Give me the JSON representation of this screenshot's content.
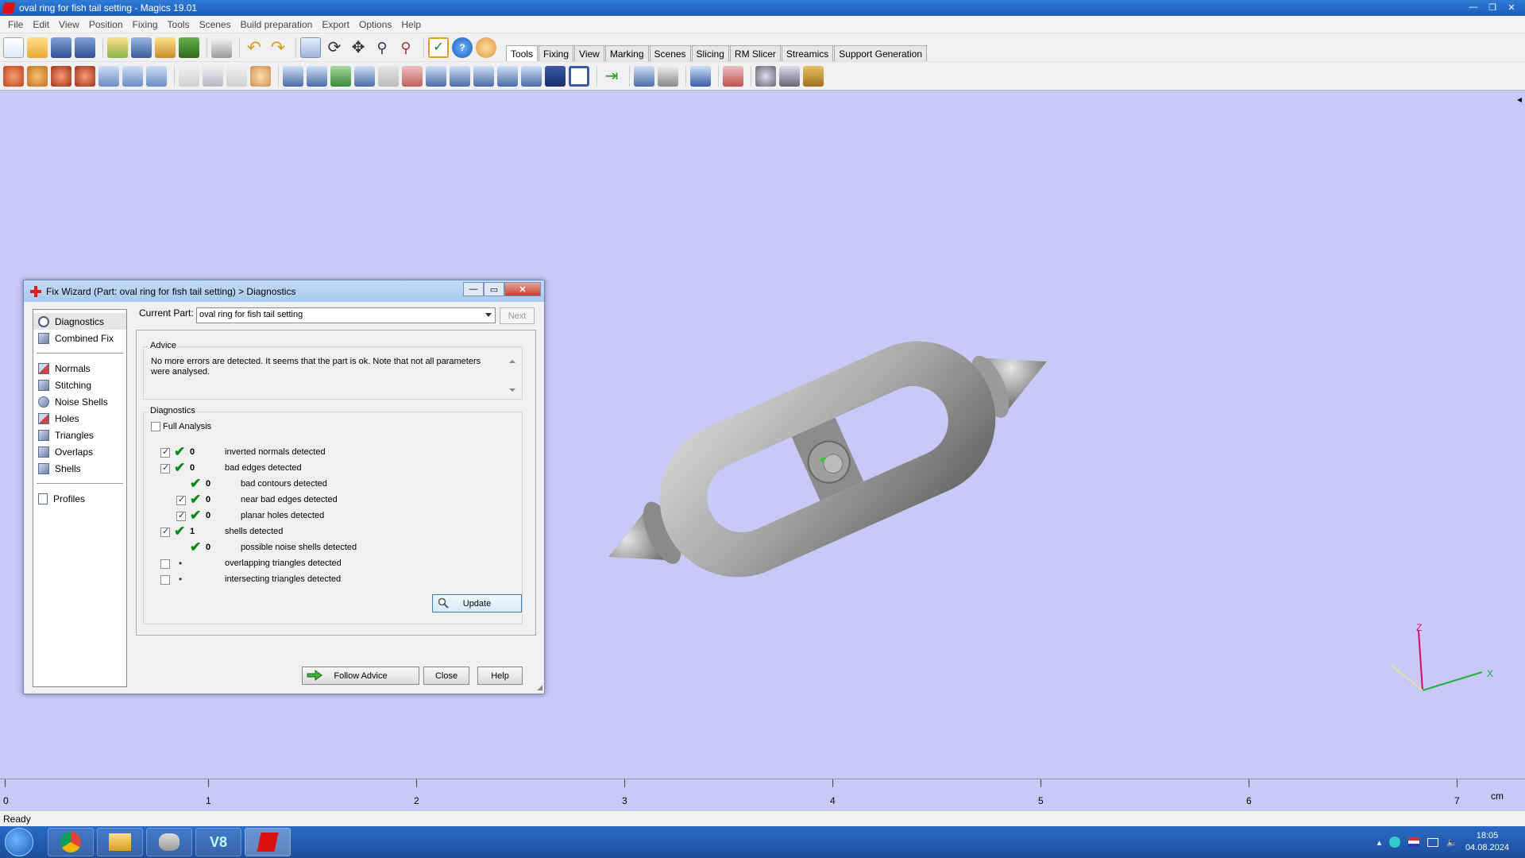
{
  "window": {
    "title": "oval ring for fish tail setting - Magics 19.01"
  },
  "menu": [
    "File",
    "Edit",
    "View",
    "Position",
    "Fixing",
    "Tools",
    "Scenes",
    "Build preparation",
    "Export",
    "Options",
    "Help"
  ],
  "tabs": [
    "Tools",
    "Fixing",
    "View",
    "Marking",
    "Scenes",
    "Slicing",
    "RM Slicer",
    "Streamics",
    "Support Generation"
  ],
  "active_tab": "Tools",
  "dialog": {
    "title": "Fix Wizard (Part: oval ring for fish tail setting) > Diagnostics",
    "nav_top": [
      {
        "label": "Diagnostics",
        "icon": "magnifier-icon"
      },
      {
        "label": "Combined Fix",
        "icon": "cube-icon"
      }
    ],
    "nav_middle": [
      {
        "label": "Normals",
        "icon": "normals-cube-icon"
      },
      {
        "label": "Stitching",
        "icon": "stitching-icon"
      },
      {
        "label": "Noise Shells",
        "icon": "noise-shells-icon"
      },
      {
        "label": "Holes",
        "icon": "holes-icon"
      },
      {
        "label": "Triangles",
        "icon": "triangles-icon"
      },
      {
        "label": "Overlaps",
        "icon": "overlaps-icon"
      },
      {
        "label": "Shells",
        "icon": "shells-icon"
      }
    ],
    "nav_bottom": [
      {
        "label": "Profiles",
        "icon": "profiles-doc-icon"
      }
    ],
    "current_part_label": "Current Part:",
    "current_part_value": "oval ring for fish tail setting",
    "next_label": "Next",
    "advice_legend": "Advice",
    "advice_text": "No more errors are detected. It seems that the part is ok. Note that not all parameters were analysed.",
    "diagnostics_legend": "Diagnostics",
    "full_analysis_label": "Full Analysis",
    "rows": [
      {
        "checkbox": true,
        "checked": true,
        "status": "check",
        "count": "0",
        "label": "inverted normals detected",
        "indent": 0
      },
      {
        "checkbox": true,
        "checked": true,
        "status": "check",
        "count": "0",
        "label": "bad edges detected",
        "indent": 0
      },
      {
        "checkbox": false,
        "checked": false,
        "status": "check",
        "count": "0",
        "label": "bad contours detected",
        "indent": 1
      },
      {
        "checkbox": true,
        "checked": true,
        "status": "check",
        "count": "0",
        "label": "near bad edges detected",
        "indent": 1
      },
      {
        "checkbox": true,
        "checked": true,
        "status": "check",
        "count": "0",
        "label": "planar holes detected",
        "indent": 1
      },
      {
        "checkbox": true,
        "checked": true,
        "status": "check",
        "count": "1",
        "label": "shells detected",
        "indent": 0
      },
      {
        "checkbox": false,
        "checked": false,
        "status": "check",
        "count": "0",
        "label": "possible noise shells detected",
        "indent": 1
      },
      {
        "checkbox": true,
        "checked": false,
        "status": "dot",
        "count": "",
        "label": "overlapping triangles detected",
        "indent": 0
      },
      {
        "checkbox": true,
        "checked": false,
        "status": "dot",
        "count": "",
        "label": "intersecting triangles detected",
        "indent": 0
      }
    ],
    "update_label": "Update",
    "follow_advice_label": "Follow Advice",
    "close_label": "Close",
    "help_label": "Help"
  },
  "ruler": {
    "labels": [
      "0",
      "1",
      "2",
      "3",
      "4",
      "5",
      "6",
      "7"
    ],
    "unit": "cm"
  },
  "axes": {
    "z": "Z",
    "x": "X"
  },
  "status": "Ready",
  "clock": {
    "time": "18:05",
    "date": "04.08.2024"
  },
  "colors": {
    "viewport_bg": "#c9c8f7",
    "check_green": "#0d8a1a",
    "title_blue": "#1b5fb8"
  }
}
